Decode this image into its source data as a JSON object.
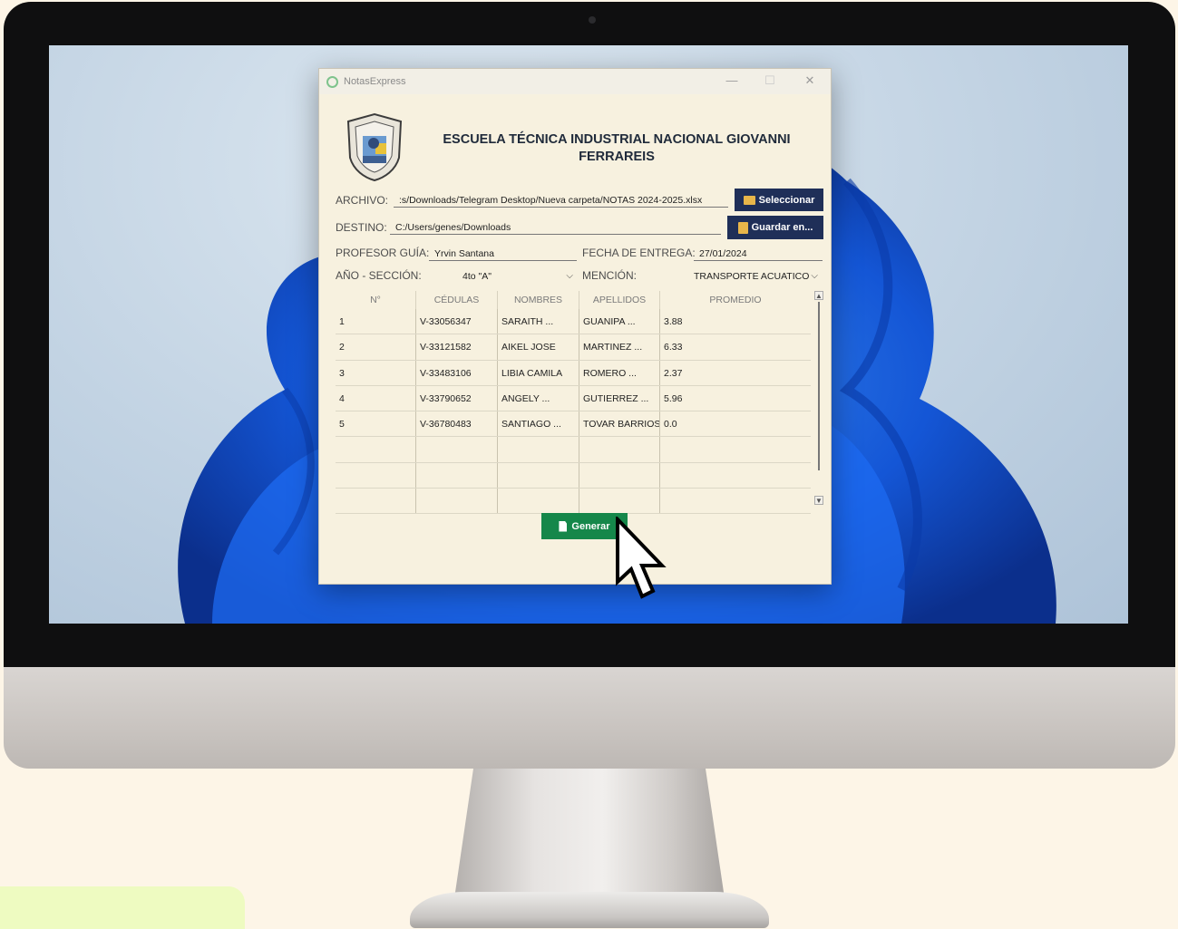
{
  "window": {
    "title": "NotasExpress",
    "controls": {
      "minimize": "—",
      "maximize": "☐",
      "close": "✕"
    }
  },
  "header": {
    "school_name": "ESCUELA TÉCNICA INDUSTRIAL NACIONAL GIOVANNI FERRAREIS"
  },
  "form": {
    "archivo": {
      "label": "ARCHIVO:",
      "value": ":s/Downloads/Telegram Desktop/Nueva carpeta/NOTAS 2024-2025.xlsx",
      "button": "Seleccionar"
    },
    "destino": {
      "label": "DESTINO:",
      "value": "C:/Users/genes/Downloads",
      "button": "Guardar en..."
    },
    "profesor": {
      "label": "PROFESOR GUÍA:",
      "value": "Yrvin Santana"
    },
    "fecha": {
      "label": "FECHA DE ENTREGA:",
      "value": "27/01/2024"
    },
    "anio": {
      "label": "AÑO - SECCIÓN:",
      "value": "4to \"A\""
    },
    "mencion": {
      "label": "MENCIÓN:",
      "value": "TRANSPORTE ACUATICO"
    }
  },
  "table": {
    "headers": [
      "N°",
      "CÉDULAS",
      "NOMBRES",
      "APELLIDOS",
      "PROMEDIO"
    ],
    "rows": [
      [
        "1",
        "V-33056347",
        "SARAITH ...",
        "GUANIPA ...",
        "3.88"
      ],
      [
        "2",
        "V-33121582",
        "AIKEL JOSE",
        "MARTINEZ ...",
        "6.33"
      ],
      [
        "3",
        "V-33483106",
        "LIBIA CAMILA",
        "ROMERO ...",
        "2.37"
      ],
      [
        "4",
        "V-33790652",
        "ANGELY ...",
        "GUTIERREZ ...",
        "5.96"
      ],
      [
        "5",
        "V-36780483",
        "SANTIAGO ...",
        "TOVAR BARRIOS",
        "0.0"
      ],
      [
        "",
        "",
        "",
        "",
        ""
      ],
      [
        "",
        "",
        "",
        "",
        ""
      ],
      [
        "",
        "",
        "",
        "",
        ""
      ]
    ]
  },
  "actions": {
    "generate": "Generar"
  },
  "icons": {
    "app": "app-icon",
    "logo": "school-shield-logo",
    "folder": "folder-icon",
    "save": "save-icon",
    "document": "document-icon",
    "cursor": "mouse-pointer-icon"
  },
  "colors": {
    "primary_button": "#1f2f58",
    "generate_button": "#15874a",
    "window_bg": "#f7f1df"
  }
}
